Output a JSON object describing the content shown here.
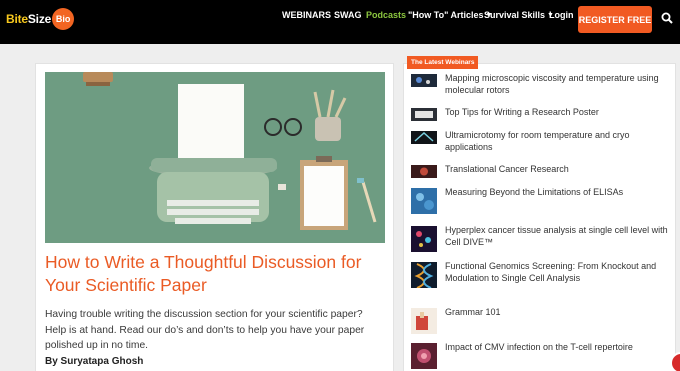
{
  "header": {
    "logo": {
      "part1": "Bite",
      "part2": "Size",
      "part3": "Bio"
    },
    "nav": [
      {
        "label": "WEBINARS"
      },
      {
        "label": "SWAG"
      },
      {
        "label": "Podcasts"
      },
      {
        "label": "\"How To\" Articles"
      },
      {
        "label": "Survival Skills"
      },
      {
        "label": "Login"
      }
    ],
    "register_label": "REGISTER FREE",
    "colors": {
      "accent": "#f15a22",
      "podcasts": "#8cc63f",
      "logo_yellow": "#f7c81e"
    }
  },
  "article": {
    "title": "How to Write a Thoughtful Discussion for Your Scientific Paper",
    "excerpt": "Having trouble writing the discussion section for your scientific paper? Help is at hand. Read our do’s and don’ts to help you have your paper polished up in no time.",
    "author": "By Suryatapa Ghosh"
  },
  "sidebar": {
    "heading": "The Latest Webinars",
    "webinars": [
      {
        "title": "Mapping microscopic viscosity and temperature using molecular rotors"
      },
      {
        "title": "Top Tips for Writing a Research Poster"
      },
      {
        "title": "Ultramicrotomy for room temperature and cryo applications"
      },
      {
        "title": "Translational Cancer Research"
      },
      {
        "title": "Measuring Beyond the Limitations of ELISAs"
      },
      {
        "title": "Hyperplex cancer tissue analysis at single cell level with Cell DIVE™"
      },
      {
        "title": "Functional Genomics Screening: From Knockout and Modulation to Single Cell Analysis"
      },
      {
        "title": "Grammar 101"
      },
      {
        "title": "Impact of CMV infection on the T-cell repertoire"
      }
    ]
  }
}
